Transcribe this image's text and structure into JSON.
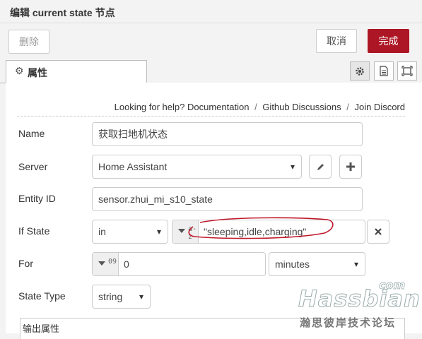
{
  "header": {
    "title": "编辑 current state 节点"
  },
  "toolbar": {
    "delete_label": "删除",
    "cancel_label": "取消",
    "done_label": "完成",
    "done_color": "#ad1625"
  },
  "tabs": {
    "properties_label": "属性"
  },
  "help": {
    "prefix": "Looking for help?",
    "documentation": "Documentation",
    "github": "Github Discussions",
    "discord": "Join Discord",
    "separator": "/"
  },
  "form": {
    "name": {
      "label": "Name",
      "value": "获取扫地机状态"
    },
    "server": {
      "label": "Server",
      "value": "Home Assistant"
    },
    "entity_id": {
      "label": "Entity ID",
      "value": "sensor.zhui_mi_s10_state"
    },
    "if_state": {
      "label": "If State",
      "operator": "in",
      "type_icon": "a-z",
      "value": "\"sleeping,idle,charging\""
    },
    "for": {
      "label": "For",
      "type_icon": "09",
      "value": "0",
      "unit": "minutes"
    },
    "state_type": {
      "label": "State Type",
      "value": "string"
    },
    "output_label": "输出属性"
  },
  "watermark": {
    "brand": "Hassbian",
    "com": "com",
    "cn": "瀚思彼岸技术论坛"
  },
  "annotation": {
    "color": "#c0182a"
  }
}
